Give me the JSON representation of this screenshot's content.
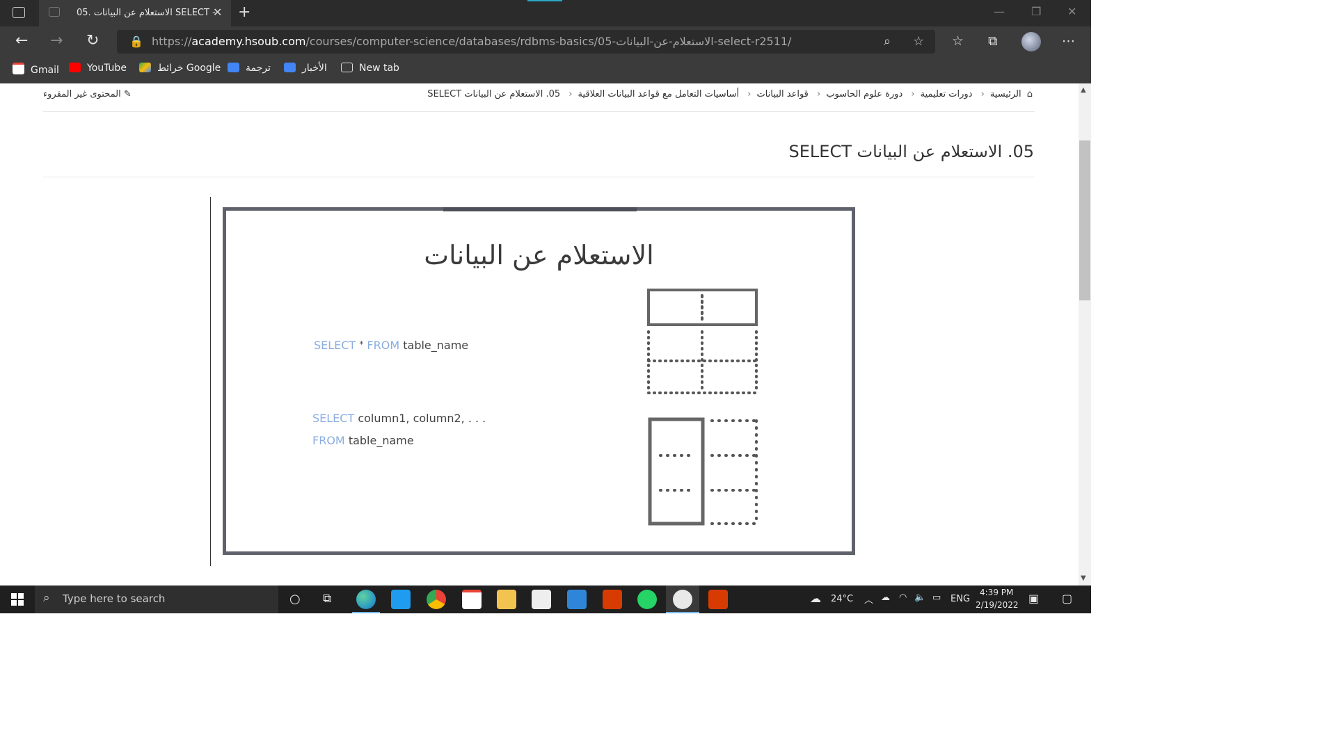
{
  "browser": {
    "tab_title": "05. الاستعلام عن البيانات SELECT -",
    "url_scheme": "https://",
    "url_domain": "academy.hsoub.com",
    "url_path": "/courses/computer-science/databases/rdbms-basics/05-الاستعلام-عن-البيانات-select-r2511/"
  },
  "favorites": [
    "Gmail",
    "YouTube",
    "خرائط Google",
    "ترجمة",
    "الأخبار",
    "New tab"
  ],
  "page": {
    "breadcrumb": [
      "الرئيسية",
      "دورات تعليمية",
      "دورة علوم الحاسوب",
      "قواعد البيانات",
      "أساسيات التعامل مع قواعد البيانات العلاقية",
      "05. الاستعلام عن البيانات SELECT"
    ],
    "unread_label": "المحتوى غير المقروء",
    "title": "05. الاستعلام عن البيانات SELECT"
  },
  "slide": {
    "title": "الاستعلام عن البيانات",
    "code1": {
      "kw1": "SELECT",
      "star": "*",
      "kw2": "FROM",
      "rest": "table_name"
    },
    "code2": {
      "kw1": "SELECT",
      "rest1": "column1, column2, . . .",
      "kw2": "FROM",
      "rest2": "table_name"
    }
  },
  "taskbar": {
    "search_placeholder": "Type here to search",
    "temperature": "24°C",
    "language": "ENG",
    "time": "4:39 PM",
    "date": "2/19/2022"
  },
  "colors": {
    "keyword": "#8aaee0",
    "slide_border": "#5f626b",
    "chrome_dark": "#2b2b2b"
  }
}
